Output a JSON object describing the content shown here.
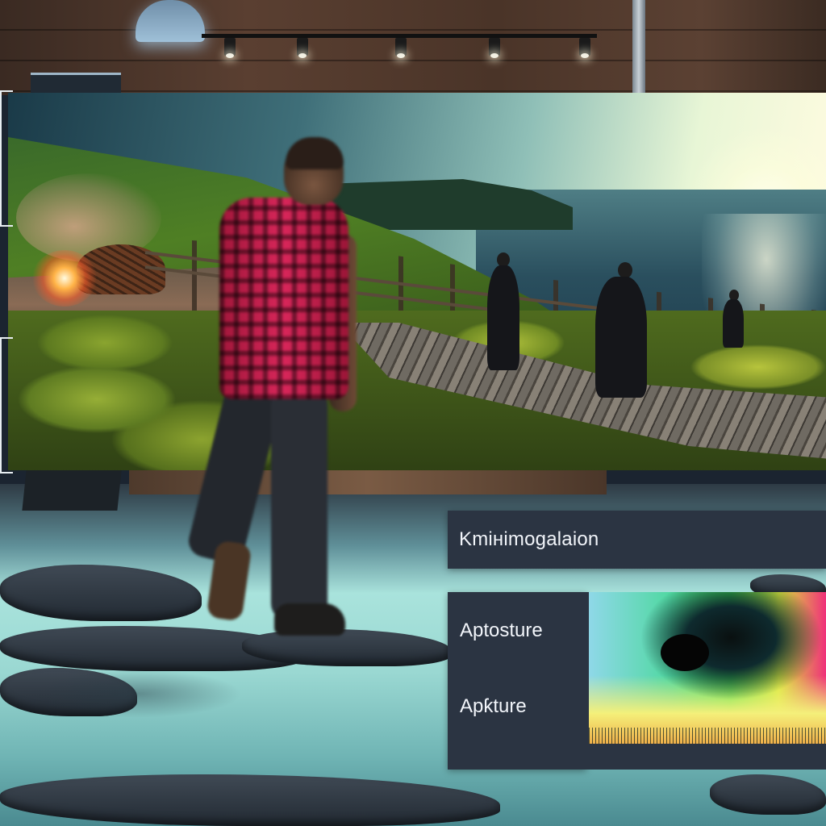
{
  "panels": {
    "title": "Kmінimogalaion",
    "label_top": "Aptosture",
    "label_bottom": "Apƙture"
  },
  "icons": {
    "ceiling_lamp": "pendant-lamp-icon",
    "track_spot": "spotlight-icon"
  },
  "colors": {
    "panel_bg": "#2b3442",
    "panel_text": "#f2f5fa",
    "shirt_accent": "#d8265a"
  }
}
